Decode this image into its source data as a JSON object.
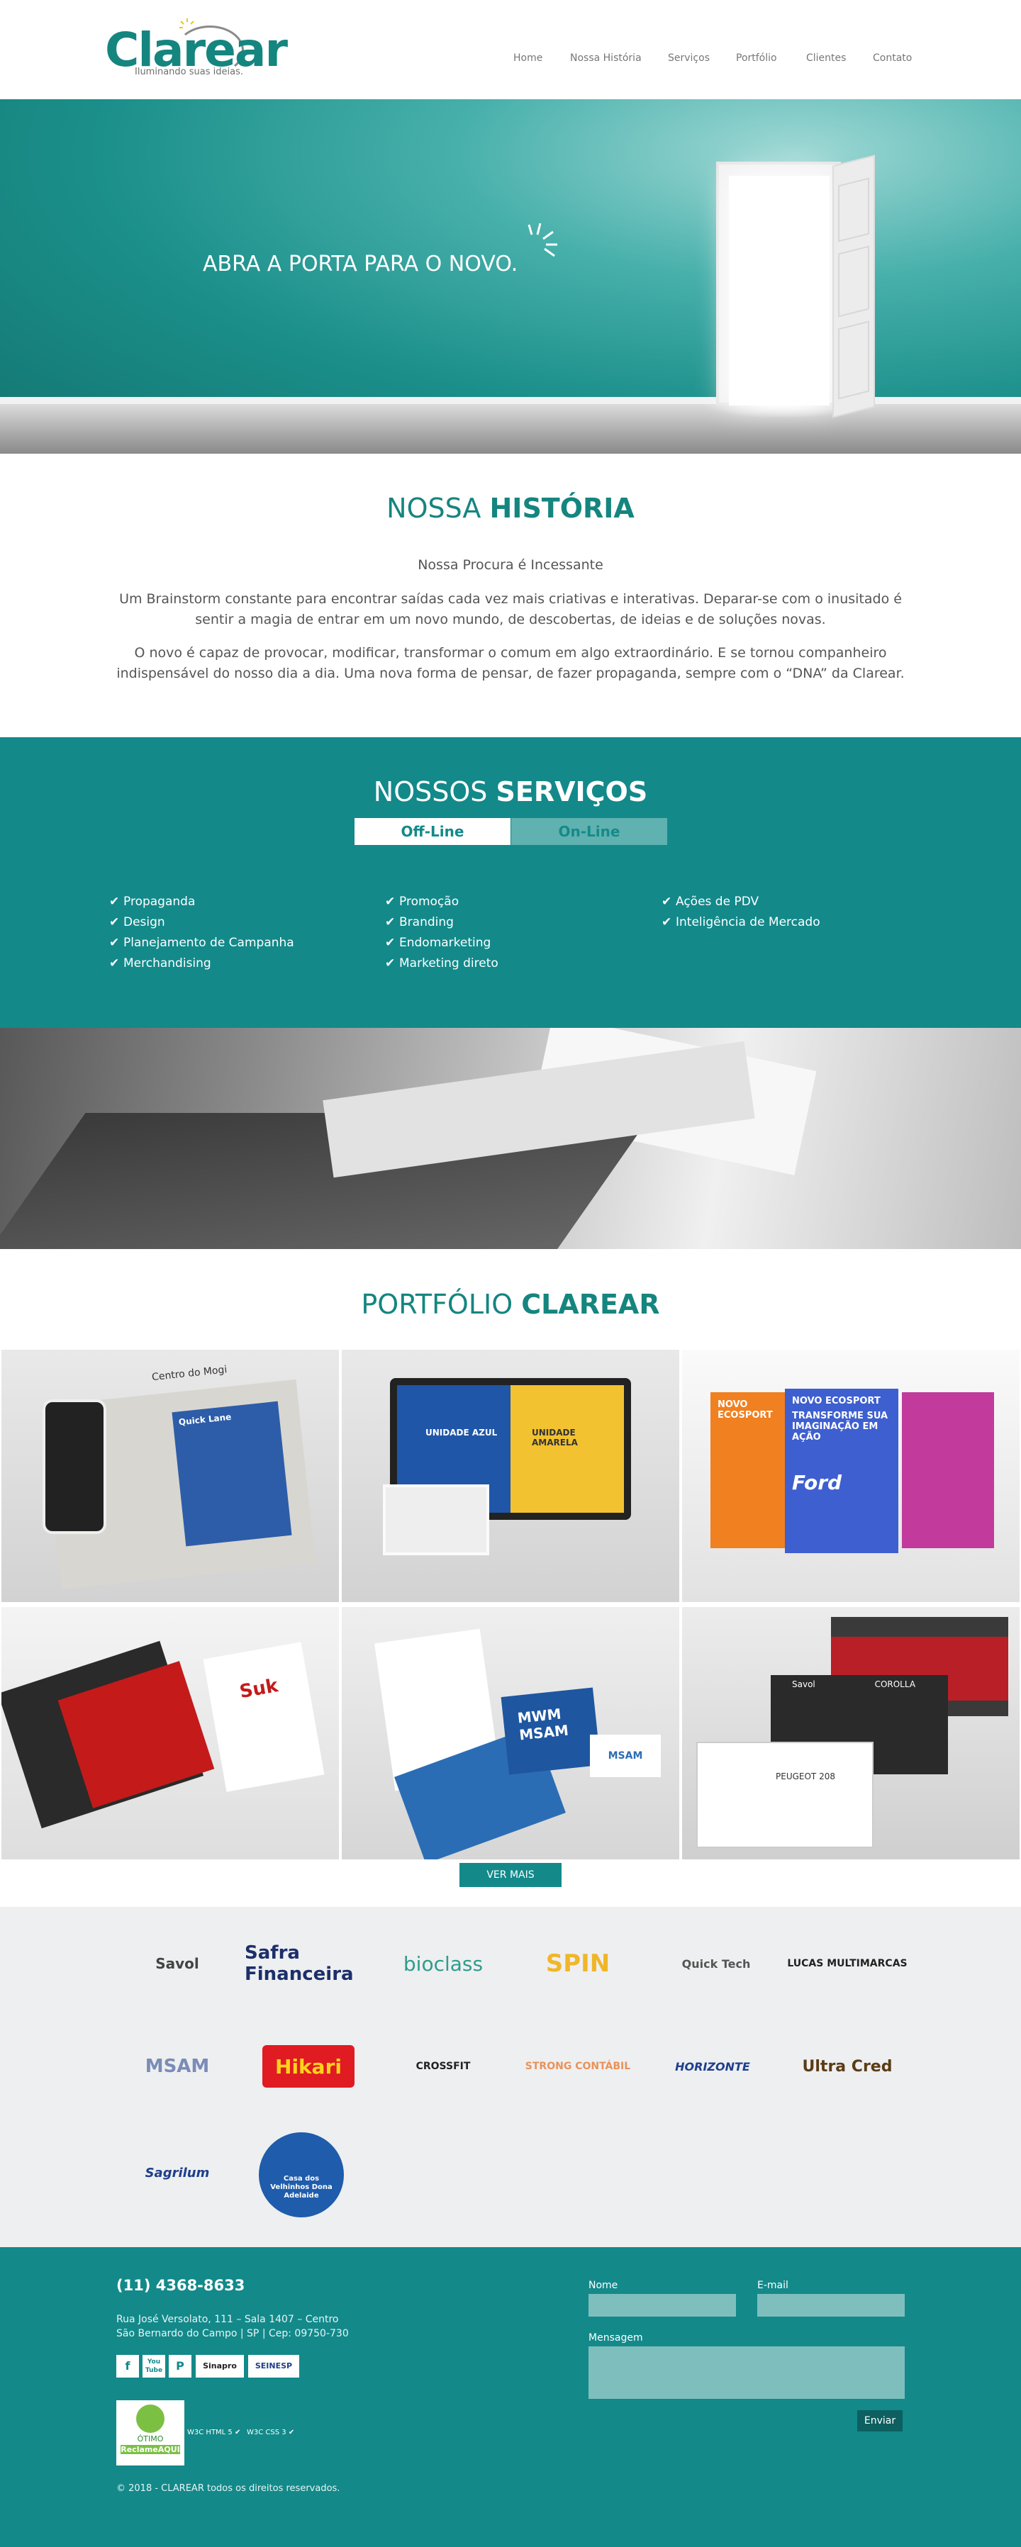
{
  "header": {
    "logo_word": "Clarear",
    "logo_tagline": "Iluminando suas ideias.",
    "nav": [
      "Home",
      "Nossa História",
      "Serviços",
      "Portfólio",
      "Clientes",
      "Contato"
    ]
  },
  "hero": {
    "headline": "ABRA A PORTA PARA O NOVO."
  },
  "historia": {
    "title_light": "NOSSA ",
    "title_bold": "HISTÓRIA",
    "subtitle": "Nossa Procura é Incessante",
    "p1": "Um Brainstorm constante para encontrar saídas cada vez mais criativas e interativas. Deparar-se com o inusitado é sentir a magia de entrar em um novo mundo, de descobertas, de ideias e de soluções novas.",
    "p2": "O novo é capaz de provocar, modificar, transformar o comum em algo extraordinário. E se tornou companheiro indispensável do nosso dia a dia. Uma nova forma de pensar, de fazer propaganda, sempre com o “DNA” da Clarear."
  },
  "servicos": {
    "title_light": "NOSSOS ",
    "title_bold": "SERVIÇOS",
    "tabs": [
      "Off-Line",
      "On-Line"
    ],
    "col1": [
      "Propaganda",
      "Design",
      "Planejamento de Campanha",
      "Merchandising"
    ],
    "col2": [
      "Promoção",
      "Branding",
      "Endomarketing",
      "Marketing direto"
    ],
    "col3": [
      "Ações de PDV",
      "Inteligência de Mercado"
    ]
  },
  "portfolio": {
    "title_light": "PORTFÓLIO ",
    "title_bold": "CLAREAR",
    "tiles": [
      {
        "texts": [
          "Centro do Mogi",
          "Quick Lane"
        ]
      },
      {
        "texts": [
          "UNIDADE AZUL",
          "UNIDADE AMARELA"
        ]
      },
      {
        "texts": [
          "NOVO ECOSPORT",
          "TRANSFORME SUA IMAGINAÇÃO EM AÇÃO",
          "Ford"
        ]
      },
      {
        "texts": [
          "Suk"
        ]
      },
      {
        "texts": [
          "MWM",
          "MSAM"
        ]
      },
      {
        "texts": [
          "Savol",
          "COROLLA",
          "PEUGEOT 208"
        ]
      }
    ],
    "ver_mais": "VER MAIS"
  },
  "clientes": {
    "logos": [
      "Savol",
      "Safra Financeira",
      "bioclass",
      "SPIN",
      "Quick Tech",
      "LUCAS MULTIMARCAS",
      "MSAM",
      "Hikari",
      "CROSSFIT",
      "STRONG CONTÁBIL",
      "HORIZONTE",
      "Ultra Cred",
      "Sagrilum",
      "Casa dos Velhinhos Dona Adelaide"
    ]
  },
  "footer": {
    "phone": "(11) 4368-8633",
    "address_line1": "Rua José Versolato, 111 – Sala 1407 – Centro",
    "address_line2": "São Bernardo do Campo | SP | Cep: 09750-730",
    "social": [
      "f",
      "You Tube",
      "P"
    ],
    "badges": [
      "Sinapro",
      "SEINESP"
    ],
    "reclame": "ÓTIMO",
    "reclame_brand": "ReclameAQUI",
    "w3c": [
      "HTML 5",
      "CSS 3"
    ],
    "copyright": "© 2018 - CLAREAR todos os direitos reservados.",
    "form": {
      "name_label": "Nome",
      "email_label": "E-mail",
      "message_label": "Mensagem",
      "send": "Enviar"
    }
  },
  "colors": {
    "teal": "#13898a",
    "teal_title": "#15857f",
    "clients_bg": "#eeeff0"
  }
}
